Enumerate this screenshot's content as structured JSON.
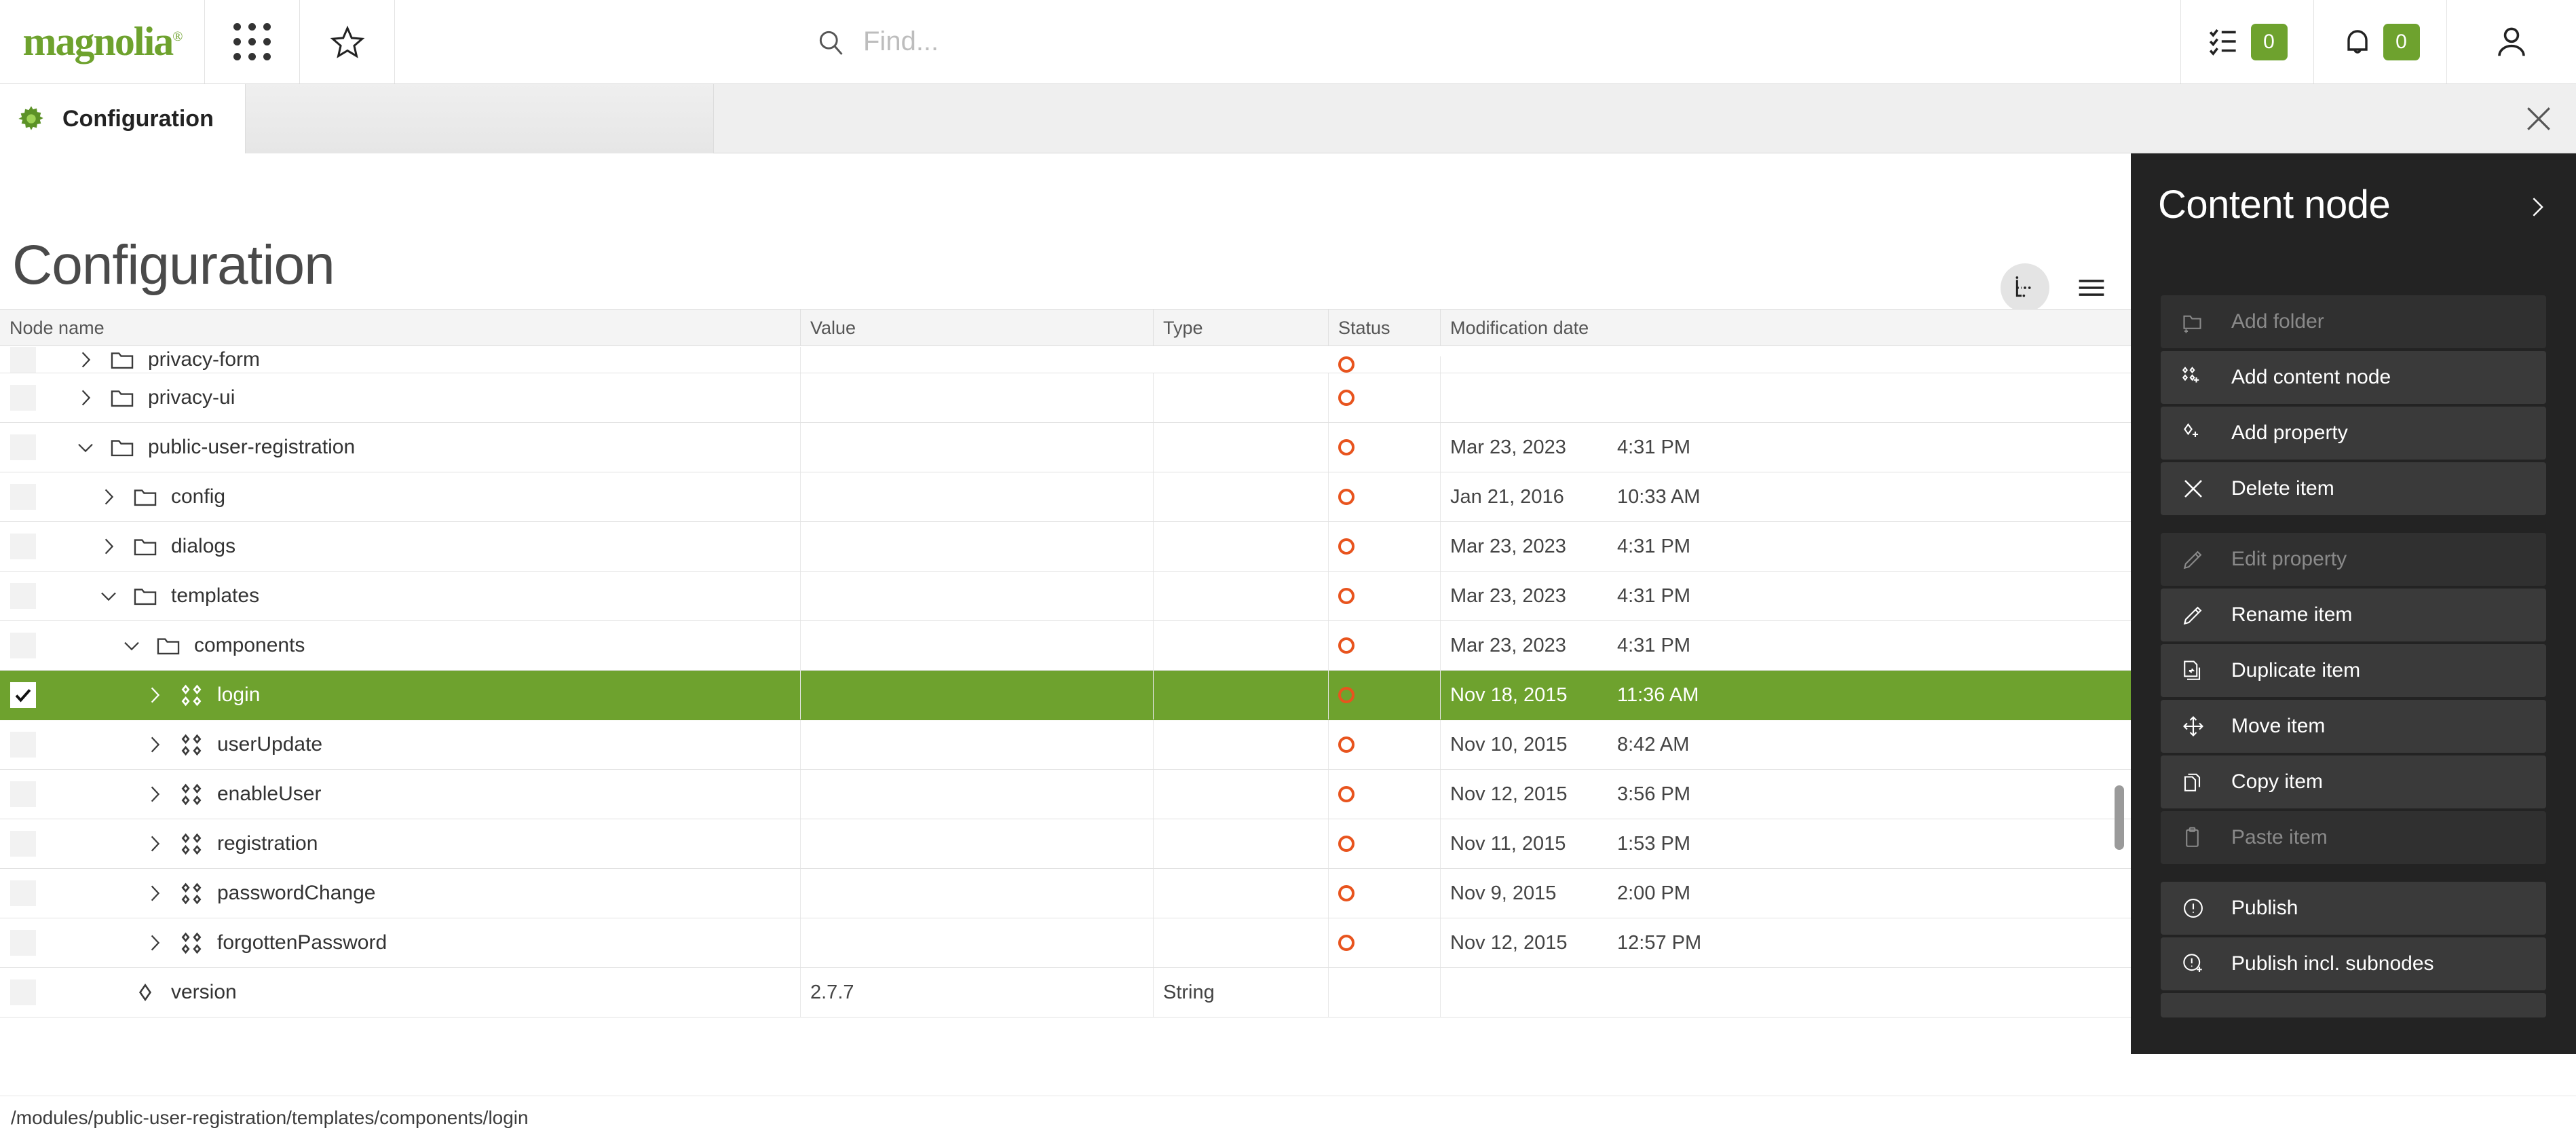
{
  "header": {
    "logo_text": "magnolia",
    "logo_mark": "®",
    "apps_icon": "apps-grid-icon",
    "favorites_icon": "star-icon",
    "search_icon": "search-icon",
    "search_placeholder": "Find...",
    "search_value": "",
    "tasks_icon": "tasks-checklist-icon",
    "tasks_count": "0",
    "notifications_icon": "bell-icon",
    "notifications_count": "0",
    "user_icon": "user-avatar-icon",
    "accent_color": "#6ea22e"
  },
  "tabbar": {
    "tab_icon": "gear-icon",
    "tab_label": "Configuration",
    "close_icon": "close-icon"
  },
  "page": {
    "title": "Configuration",
    "view_tree_icon": "tree-view-icon",
    "view_list_icon": "list-view-icon",
    "active_view": "tree"
  },
  "table": {
    "columns": [
      "Node name",
      "Value",
      "Type",
      "Status",
      "Modification date"
    ],
    "rows": [
      {
        "name": "privacy-form",
        "indent": 1,
        "icon": "folder-icon",
        "twisty": "right",
        "value": "",
        "type": "",
        "status": "modified",
        "date": "",
        "time": "",
        "selected": false,
        "checked": false,
        "clipped": true
      },
      {
        "name": "privacy-ui",
        "indent": 1,
        "icon": "folder-icon",
        "twisty": "right",
        "value": "",
        "type": "",
        "status": "modified",
        "date": "",
        "time": "",
        "selected": false,
        "checked": false
      },
      {
        "name": "public-user-registration",
        "indent": 1,
        "icon": "folder-icon",
        "twisty": "down",
        "value": "",
        "type": "",
        "status": "modified",
        "date": "Mar 23, 2023",
        "time": "4:31 PM",
        "selected": false,
        "checked": false
      },
      {
        "name": "config",
        "indent": 2,
        "icon": "folder-icon",
        "twisty": "right",
        "value": "",
        "type": "",
        "status": "modified",
        "date": "Jan 21, 2016",
        "time": "10:33 AM",
        "selected": false,
        "checked": false
      },
      {
        "name": "dialogs",
        "indent": 2,
        "icon": "folder-icon",
        "twisty": "right",
        "value": "",
        "type": "",
        "status": "modified",
        "date": "Mar 23, 2023",
        "time": "4:31 PM",
        "selected": false,
        "checked": false
      },
      {
        "name": "templates",
        "indent": 2,
        "icon": "folder-icon",
        "twisty": "down",
        "value": "",
        "type": "",
        "status": "modified",
        "date": "Mar 23, 2023",
        "time": "4:31 PM",
        "selected": false,
        "checked": false
      },
      {
        "name": "components",
        "indent": 3,
        "icon": "folder-icon",
        "twisty": "down",
        "value": "",
        "type": "",
        "status": "modified",
        "date": "Mar 23, 2023",
        "time": "4:31 PM",
        "selected": false,
        "checked": false
      },
      {
        "name": "login",
        "indent": 4,
        "icon": "content-node-icon",
        "twisty": "right",
        "value": "",
        "type": "",
        "status": "modified",
        "date": "Nov 18, 2015",
        "time": "11:36 AM",
        "selected": true,
        "checked": true
      },
      {
        "name": "userUpdate",
        "indent": 4,
        "icon": "content-node-icon",
        "twisty": "right",
        "value": "",
        "type": "",
        "status": "modified",
        "date": "Nov 10, 2015",
        "time": "8:42 AM",
        "selected": false,
        "checked": false
      },
      {
        "name": "enableUser",
        "indent": 4,
        "icon": "content-node-icon",
        "twisty": "right",
        "value": "",
        "type": "",
        "status": "modified",
        "date": "Nov 12, 2015",
        "time": "3:56 PM",
        "selected": false,
        "checked": false
      },
      {
        "name": "registration",
        "indent": 4,
        "icon": "content-node-icon",
        "twisty": "right",
        "value": "",
        "type": "",
        "status": "modified",
        "date": "Nov 11, 2015",
        "time": "1:53 PM",
        "selected": false,
        "checked": false
      },
      {
        "name": "passwordChange",
        "indent": 4,
        "icon": "content-node-icon",
        "twisty": "right",
        "value": "",
        "type": "",
        "status": "modified",
        "date": "Nov 9, 2015",
        "time": "2:00 PM",
        "selected": false,
        "checked": false
      },
      {
        "name": "forgottenPassword",
        "indent": 4,
        "icon": "content-node-icon",
        "twisty": "right",
        "value": "",
        "type": "",
        "status": "modified",
        "date": "Nov 12, 2015",
        "time": "12:57 PM",
        "selected": false,
        "checked": false
      },
      {
        "name": "version",
        "indent": 2,
        "icon": "property-icon",
        "twisty": "none",
        "value": "2.7.7",
        "type": "String",
        "status": "none",
        "date": "",
        "time": "",
        "selected": false,
        "checked": false
      }
    ]
  },
  "panel": {
    "title": "Content node",
    "collapse_icon": "chevron-right-icon",
    "groups": [
      {
        "items": [
          {
            "label": "Add folder",
            "icon": "add-folder-icon",
            "disabled": true
          },
          {
            "label": "Add content node",
            "icon": "add-content-node-icon",
            "disabled": false
          },
          {
            "label": "Add property",
            "icon": "add-property-icon",
            "disabled": false
          },
          {
            "label": "Delete item",
            "icon": "close-x-icon",
            "disabled": false
          }
        ]
      },
      {
        "items": [
          {
            "label": "Edit property",
            "icon": "pencil-icon",
            "disabled": true
          },
          {
            "label": "Rename item",
            "icon": "pencil-icon",
            "disabled": false
          },
          {
            "label": "Duplicate item",
            "icon": "duplicate-icon",
            "disabled": false
          },
          {
            "label": "Move item",
            "icon": "move-arrows-icon",
            "disabled": false
          },
          {
            "label": "Copy item",
            "icon": "copy-icon",
            "disabled": false
          },
          {
            "label": "Paste item",
            "icon": "clipboard-icon",
            "disabled": true
          }
        ]
      },
      {
        "items": [
          {
            "label": "Publish",
            "icon": "publish-icon",
            "disabled": false
          },
          {
            "label": "Publish incl. subnodes",
            "icon": "publish-subnodes-icon",
            "disabled": false
          }
        ]
      }
    ]
  },
  "footer": {
    "path": "/modules/public-user-registration/templates/components/login"
  }
}
